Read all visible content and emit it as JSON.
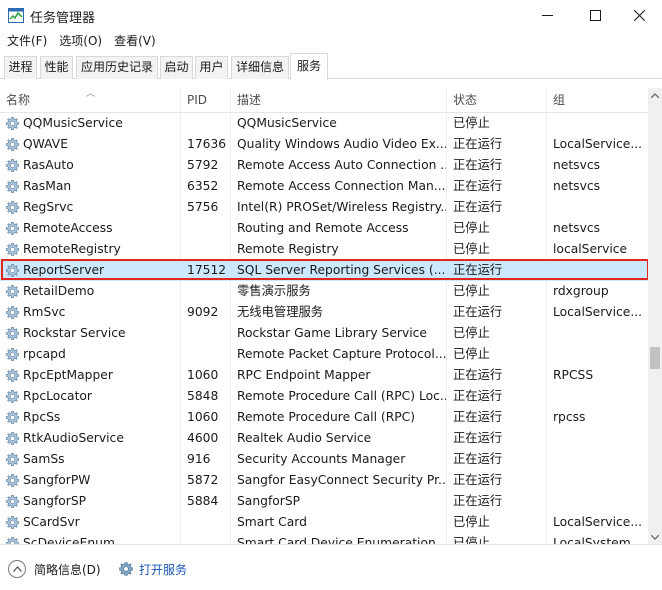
{
  "window": {
    "title": "任务管理器"
  },
  "menu": [
    "文件(F)",
    "选项(O)",
    "查看(V)"
  ],
  "tabs": [
    {
      "label": "进程"
    },
    {
      "label": "性能"
    },
    {
      "label": "应用历史记录"
    },
    {
      "label": "启动"
    },
    {
      "label": "用户"
    },
    {
      "label": "详细信息"
    },
    {
      "label": "服务",
      "active": true
    }
  ],
  "columns": {
    "name": "名称",
    "pid": "PID",
    "desc": "描述",
    "status": "状态",
    "group": "组"
  },
  "services": [
    {
      "name": "QQMusicService",
      "pid": "",
      "desc": "QQMusicService",
      "status": "已停止",
      "group": ""
    },
    {
      "name": "QWAVE",
      "pid": "17636",
      "desc": "Quality Windows Audio Video Ex...",
      "status": "正在运行",
      "group": "LocalService..."
    },
    {
      "name": "RasAuto",
      "pid": "5792",
      "desc": "Remote Access Auto Connection ...",
      "status": "正在运行",
      "group": "netsvcs"
    },
    {
      "name": "RasMan",
      "pid": "6352",
      "desc": "Remote Access Connection Man...",
      "status": "正在运行",
      "group": "netsvcs"
    },
    {
      "name": "RegSrvc",
      "pid": "5756",
      "desc": "Intel(R) PROSet/Wireless Registry...",
      "status": "正在运行",
      "group": ""
    },
    {
      "name": "RemoteAccess",
      "pid": "",
      "desc": "Routing and Remote Access",
      "status": "已停止",
      "group": "netsvcs"
    },
    {
      "name": "RemoteRegistry",
      "pid": "",
      "desc": "Remote Registry",
      "status": "已停止",
      "group": "localService"
    },
    {
      "name": "ReportServer",
      "pid": "17512",
      "desc": "SQL Server Reporting Services (...",
      "status": "正在运行",
      "group": "",
      "selected": true
    },
    {
      "name": "RetailDemo",
      "pid": "",
      "desc": "零售演示服务",
      "status": "已停止",
      "group": "rdxgroup"
    },
    {
      "name": "RmSvc",
      "pid": "9092",
      "desc": "无线电管理服务",
      "status": "正在运行",
      "group": "LocalService..."
    },
    {
      "name": "Rockstar Service",
      "pid": "",
      "desc": "Rockstar Game Library Service",
      "status": "已停止",
      "group": ""
    },
    {
      "name": "rpcapd",
      "pid": "",
      "desc": "Remote Packet Capture Protocol...",
      "status": "已停止",
      "group": ""
    },
    {
      "name": "RpcEptMapper",
      "pid": "1060",
      "desc": "RPC Endpoint Mapper",
      "status": "正在运行",
      "group": "RPCSS"
    },
    {
      "name": "RpcLocator",
      "pid": "5848",
      "desc": "Remote Procedure Call (RPC) Loc...",
      "status": "正在运行",
      "group": ""
    },
    {
      "name": "RpcSs",
      "pid": "1060",
      "desc": "Remote Procedure Call (RPC)",
      "status": "正在运行",
      "group": "rpcss"
    },
    {
      "name": "RtkAudioService",
      "pid": "4600",
      "desc": "Realtek Audio Service",
      "status": "正在运行",
      "group": ""
    },
    {
      "name": "SamSs",
      "pid": "916",
      "desc": "Security Accounts Manager",
      "status": "正在运行",
      "group": ""
    },
    {
      "name": "SangforPW",
      "pid": "5872",
      "desc": "Sangfor EasyConnect Security Pr...",
      "status": "正在运行",
      "group": ""
    },
    {
      "name": "SangforSP",
      "pid": "5884",
      "desc": "SangforSP",
      "status": "正在运行",
      "group": ""
    },
    {
      "name": "SCardSvr",
      "pid": "",
      "desc": "Smart Card",
      "status": "已停止",
      "group": "LocalService..."
    },
    {
      "name": "ScDeviceEnum",
      "pid": "",
      "desc": "Smart Card Device Enumeration ...",
      "status": "已停止",
      "group": "LocalSystem..."
    }
  ],
  "footer": {
    "fewer_details": "简略信息(D)",
    "open_services": "打开服务"
  },
  "colors": {
    "selection": "#cce8ff",
    "highlight_border": "#e0281e",
    "link": "#1a56b7"
  },
  "icons": {
    "service": "gear-icon",
    "app": "task-manager-icon"
  }
}
